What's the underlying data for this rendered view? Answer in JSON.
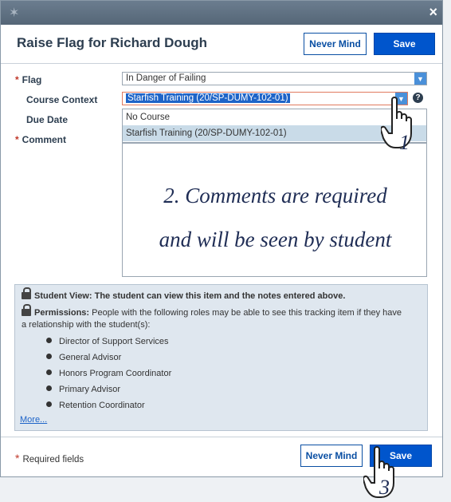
{
  "dialog": {
    "title": "Raise Flag for Richard Dough",
    "close_symbol": "×",
    "never_mind_label": "Never Mind",
    "save_label": "Save"
  },
  "form": {
    "required_marker": "*",
    "flag_label": "Flag",
    "flag_value": "In Danger of Failing",
    "course_context_label": "Course Context",
    "course_context_value": "Starfish Training (20/SP-DUMY-102-01)",
    "course_options": [
      "No Course",
      "Starfish Training (20/SP-DUMY-102-01)"
    ],
    "due_date_label": "Due Date",
    "comment_label": "Comment",
    "help_symbol": "?"
  },
  "annotations": {
    "step1": "1",
    "step2_line1": "2. Comments are required",
    "step2_line2": "and will be seen by student",
    "step3": "3"
  },
  "info": {
    "student_view_heading": "Student View:",
    "student_view_text": "The student can view this item and the notes entered above.",
    "permissions_heading": "Permissions:",
    "permissions_text_1": "People with the following roles may be able to see this tracking item if they have",
    "permissions_text_2": "a relationship with the student(s):",
    "roles": [
      "Director of Support Services",
      "General Advisor",
      "Honors Program Coordinator",
      "Primary Advisor",
      "Retention Coordinator"
    ],
    "more_link": "More..."
  },
  "footer": {
    "required_note": "Required fields",
    "never_mind_label": "Never Mind",
    "save_label": "Save"
  },
  "icons": {
    "logo": "star-logo-icon",
    "close": "close-icon",
    "dropdown": "chevron-down-icon",
    "help": "help-icon",
    "lock": "lock-icon",
    "cursor": "hand-pointer-icon"
  },
  "colors": {
    "primary": "#0055cc",
    "required": "#c0392b",
    "panel": "#dfe7ef",
    "annotation": "#1f2d55"
  }
}
